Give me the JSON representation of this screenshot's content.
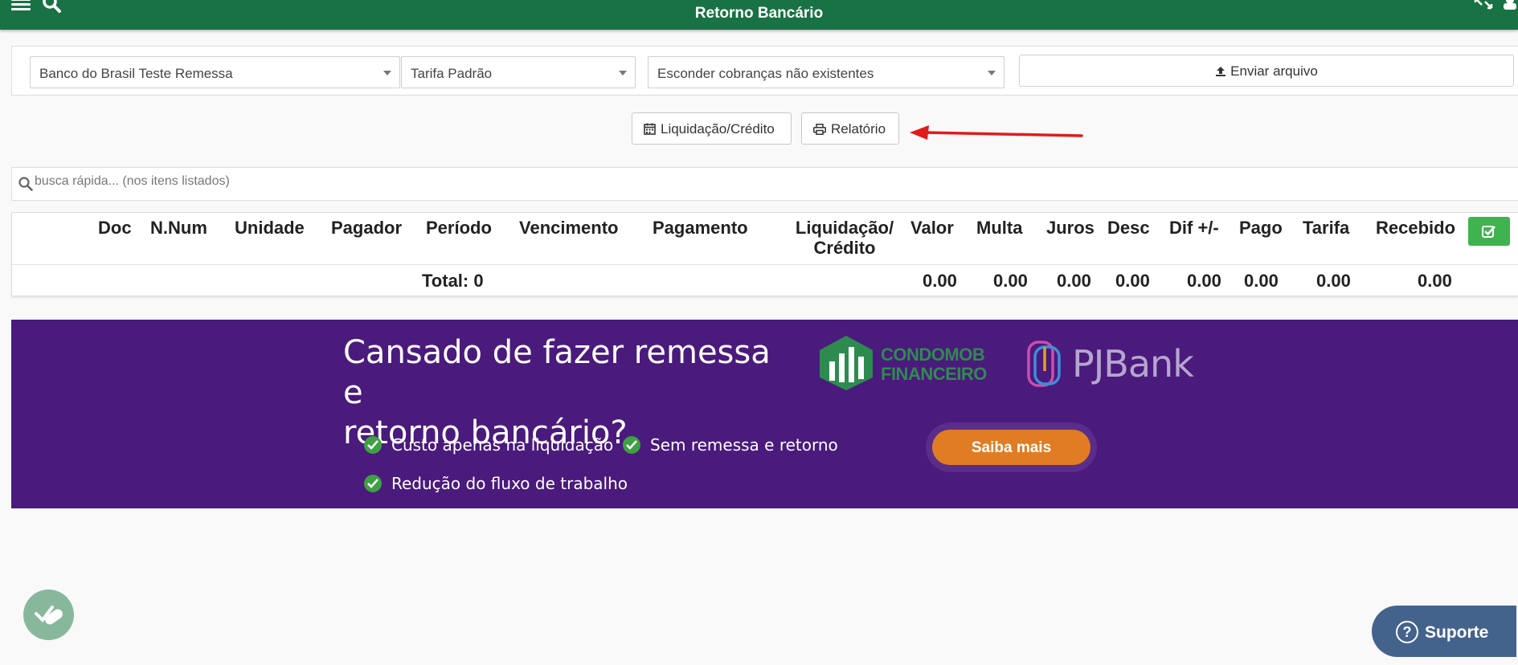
{
  "header": {
    "title": "Retorno Bancário",
    "menu_icon": "hamburger-icon",
    "search_icon": "search-icon",
    "expand_icon": "expand-icon",
    "user_icon": "user-icon"
  },
  "filters": {
    "bank": "Banco do Brasil Teste Remessa",
    "tarifa": "Tarifa Padrão",
    "visibility": "Esconder cobranças não existentes",
    "upload_label": "Enviar arquivo"
  },
  "actions": {
    "liquidacao_label": "Liquidação/Crédito",
    "relatorio_label": "Relatório"
  },
  "search": {
    "placeholder": "busca rápida... (nos itens listados)"
  },
  "table": {
    "columns": [
      "Doc",
      "N.Num",
      "Unidade",
      "Pagador",
      "Período",
      "Vencimento",
      "Pagamento",
      "Liquidação/",
      "Crédito",
      "Valor",
      "Multa",
      "Juros",
      "Desc",
      "Dif +/-",
      "Pago",
      "Tarifa",
      "Recebido"
    ],
    "total_label": "Total: 0",
    "totals": {
      "valor": "0.00",
      "multa": "0.00",
      "juros": "0.00",
      "desc": "0.00",
      "dif": "0.00",
      "pago": "0.00",
      "tarifa": "0.00",
      "recebido": "0.00"
    }
  },
  "banner": {
    "headline_line1": "Cansado de fazer remessa e",
    "headline_line2": "retorno bancário?",
    "bullets": [
      "Custo apenas na liquidação",
      "Sem remessa e retorno",
      "Redução do fluxo de trabalho"
    ],
    "cta": "Saiba mais",
    "logo1_line1": "CONDOMOB",
    "logo1_line2": "FINANCEIRO",
    "logo2": "PJBank",
    "bg_color": "#4a1a7c",
    "cta_color": "#e07d24"
  },
  "support": {
    "label": "Suporte"
  },
  "colors": {
    "header_green": "#187243",
    "annotation_red": "#e01b1b"
  }
}
